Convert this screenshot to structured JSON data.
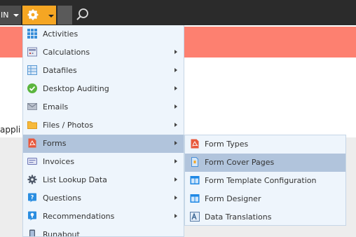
{
  "topbar": {
    "admin_label": "IN",
    "colors": {
      "bar": "#2b2b2b",
      "settings": "#f5a623",
      "banner": "#fd8070"
    }
  },
  "background": {
    "partial_text": "appli"
  },
  "menu": {
    "items": [
      {
        "label": "Activities",
        "icon": "grid-icon",
        "has_submenu": false
      },
      {
        "label": "Calculations",
        "icon": "calculator-icon",
        "has_submenu": true
      },
      {
        "label": "Datafiles",
        "icon": "table-icon",
        "has_submenu": true
      },
      {
        "label": "Desktop Auditing",
        "icon": "check-circle-icon",
        "has_submenu": true
      },
      {
        "label": "Emails",
        "icon": "envelope-icon",
        "has_submenu": true
      },
      {
        "label": "Files / Photos",
        "icon": "folder-icon",
        "has_submenu": true
      },
      {
        "label": "Forms",
        "icon": "pdf-icon",
        "has_submenu": true,
        "active": true
      },
      {
        "label": "Invoices",
        "icon": "invoice-icon",
        "has_submenu": true
      },
      {
        "label": "List Lookup Data",
        "icon": "gear-icon",
        "has_submenu": true
      },
      {
        "label": "Questions",
        "icon": "question-icon",
        "has_submenu": true
      },
      {
        "label": "Recommendations",
        "icon": "lightbulb-icon",
        "has_submenu": true
      },
      {
        "label": "Runabout",
        "icon": "phone-icon",
        "has_submenu": false
      }
    ]
  },
  "submenu": {
    "items": [
      {
        "label": "Form Types",
        "icon": "pdf-icon"
      },
      {
        "label": "Form Cover Pages",
        "icon": "page-icon",
        "active": true
      },
      {
        "label": "Form Template Configuration",
        "icon": "window-icon"
      },
      {
        "label": "Form Designer",
        "icon": "window-icon"
      },
      {
        "label": "Data Translations",
        "icon": "translate-icon"
      }
    ]
  }
}
